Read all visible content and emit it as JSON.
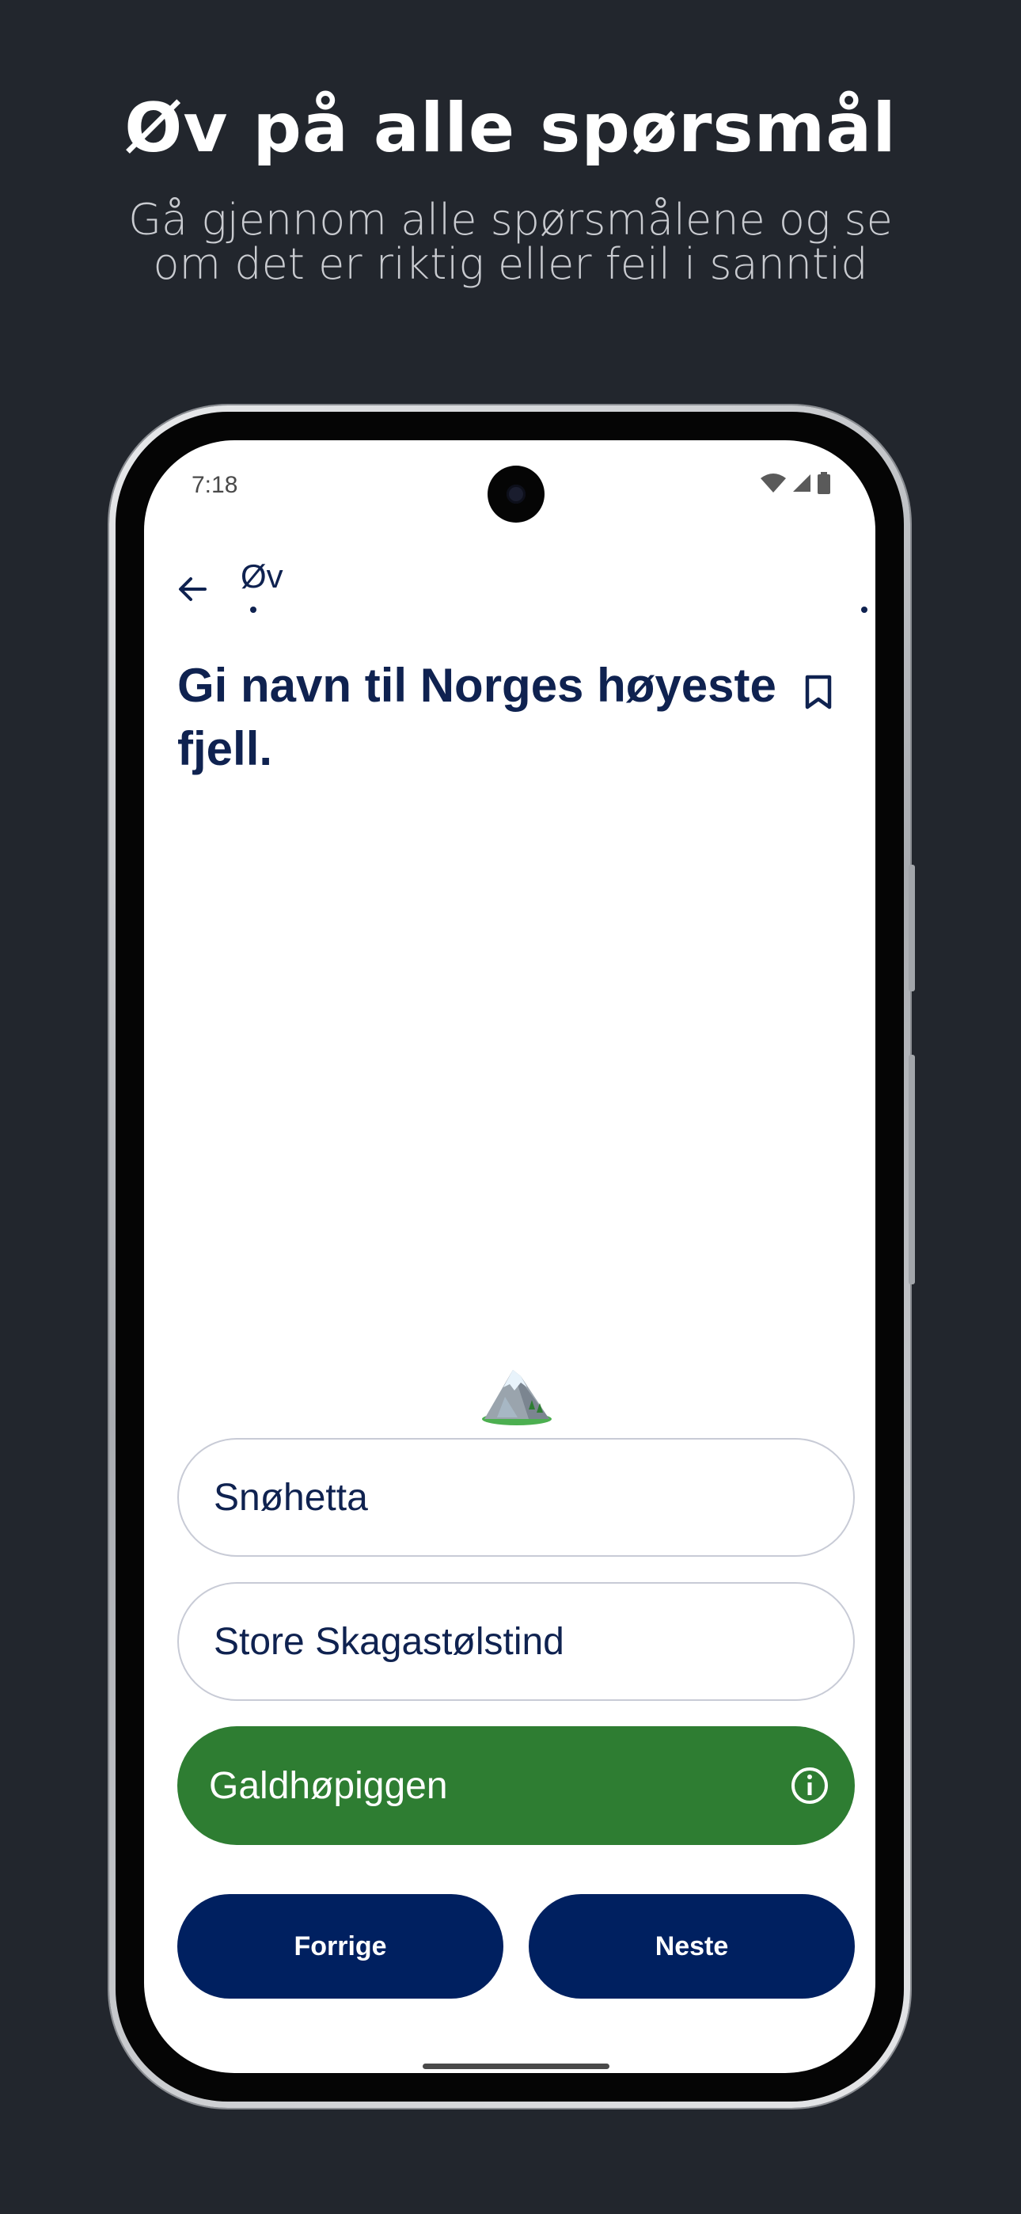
{
  "promo": {
    "title": "Øv på alle spørsmål",
    "subtitle": "Gå gjennom alle spørsmålene og se om det er riktig eller feil i sanntid"
  },
  "status_bar": {
    "time": "7:18",
    "icons": [
      "wifi-icon",
      "signal-icon",
      "battery-icon"
    ]
  },
  "app_bar": {
    "title": "Øv",
    "back_icon": "arrow-back-icon"
  },
  "question": {
    "text": "Gi navn til Norges høyeste fjell.",
    "bookmark_icon": "bookmark-outline-icon",
    "illustration": "snow-capped-mountain-emoji"
  },
  "options": [
    {
      "label": "Snøhetta",
      "state": "neutral"
    },
    {
      "label": "Store Skagastølstind",
      "state": "neutral"
    },
    {
      "label": "Galdhøpiggen",
      "state": "correct",
      "icon": "info-icon"
    }
  ],
  "navigation": {
    "previous_label": "Forrige",
    "next_label": "Neste"
  },
  "colors": {
    "background": "#22262d",
    "primary_navy": "#002060",
    "text_navy": "#0f2250",
    "correct_green": "#2e7d32",
    "option_border": "#c8cbd6"
  }
}
